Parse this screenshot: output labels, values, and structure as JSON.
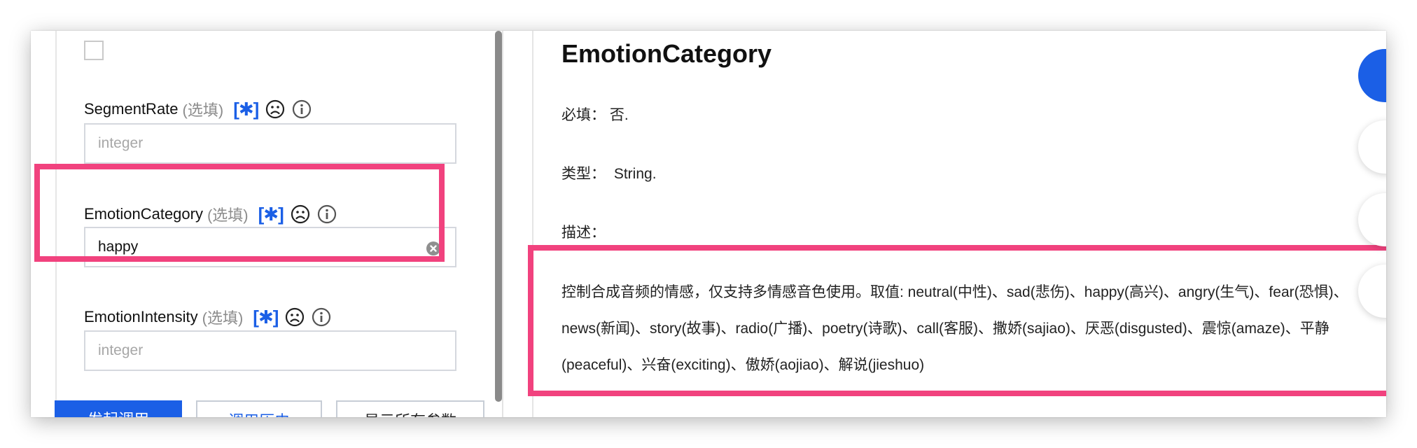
{
  "form": {
    "fields": [
      {
        "name": "SegmentRate",
        "optional": "(选填)",
        "placeholder": "integer",
        "value": ""
      },
      {
        "name": "EmotionCategory",
        "optional": "(选填)",
        "placeholder": "",
        "value": "happy"
      },
      {
        "name": "EmotionIntensity",
        "optional": "(选填)",
        "placeholder": "integer",
        "value": ""
      }
    ],
    "marker": "[✱]"
  },
  "buttons": {
    "invoke": "发起调用",
    "history": "调用历史",
    "show_all": "显示所有参数"
  },
  "doc": {
    "title": "EmotionCategory",
    "required_label": "必填：",
    "required_value": "否.",
    "type_label": "类型：",
    "type_value": "String.",
    "desc_label": "描述：",
    "description": "控制合成音频的情感，仅支持多情感音色使用。取值: neutral(中性)、sad(悲伤)、happy(高兴)、angry(生气)、fear(恐惧)、news(新闻)、story(故事)、radio(广播)、poetry(诗歌)、call(客服)、撒娇(sajiao)、厌恶(disgusted)、震惊(amaze)、平静(peaceful)、兴奋(exciting)、傲娇(aojiao)、解说(jieshuo)"
  },
  "colors": {
    "accent": "#1b5fe6",
    "highlight": "#f1427e"
  }
}
